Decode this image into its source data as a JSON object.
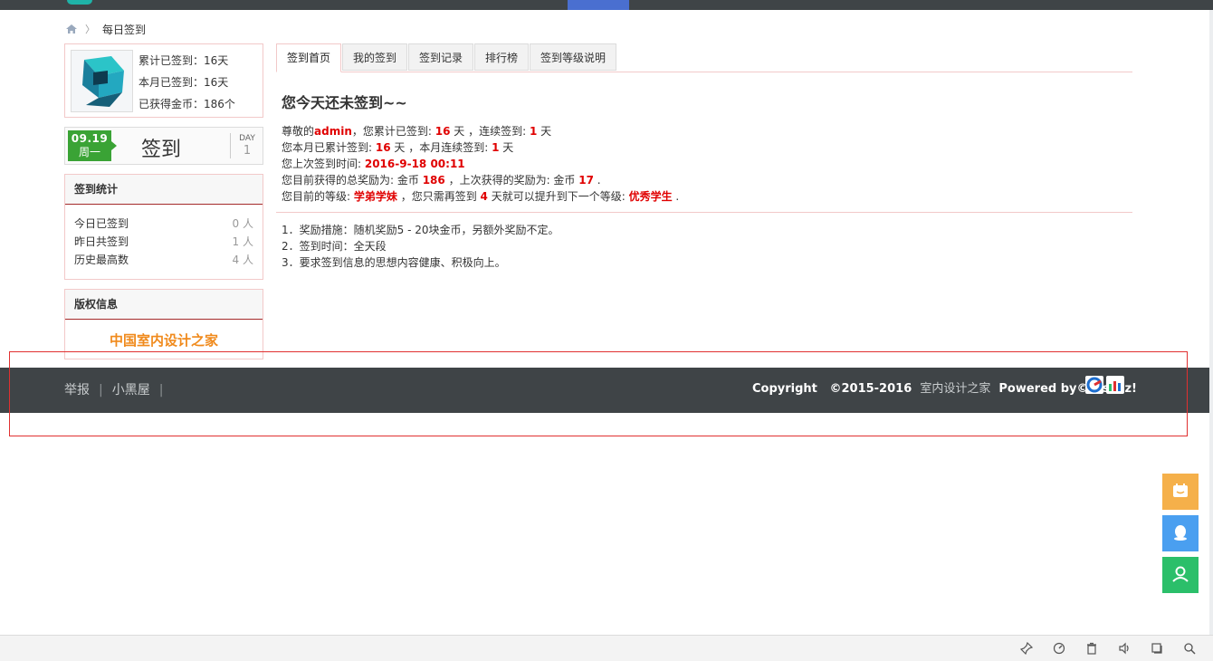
{
  "breadcrumb": {
    "current": "每日签到"
  },
  "user_card": {
    "total_signed": "累计已签到：16天",
    "month_signed": "本月已签到：16天",
    "coins": "已获得金币：186个"
  },
  "sign_box": {
    "date": "09.19",
    "weekday": "周一",
    "label": "签到",
    "day_label": "DAY",
    "day_value": "1"
  },
  "stats_panel": {
    "title": "签到统计",
    "rows": [
      {
        "label": "今日已签到",
        "value": "0 人"
      },
      {
        "label": "昨日共签到",
        "value": "1 人"
      },
      {
        "label": "历史最高数",
        "value": "4 人"
      }
    ]
  },
  "copyright_panel": {
    "title": "版权信息",
    "brand": "中国室内设计之家"
  },
  "tabs": [
    "签到首页",
    "我的签到",
    "签到记录",
    "排行榜",
    "签到等级说明"
  ],
  "main": {
    "heading": "您今天还未签到~~",
    "l1": {
      "a": "尊敬的",
      "user": "admin",
      "b": "，您累计已签到: ",
      "total": "16",
      "c": " 天 ，连续签到: ",
      "streak": "1",
      "d": " 天"
    },
    "l2": {
      "a": "您本月已累计签到: ",
      "month": "16",
      "b": " 天 ，本月连续签到: ",
      "mstreak": "1",
      "c": " 天"
    },
    "l3": {
      "a": "您上次签到时间: ",
      "time": "2016-9-18 00:11"
    },
    "l4": {
      "a": "您目前获得的总奖励为: 金币 ",
      "total_coins": "186",
      "b": " ，上次获得的奖励为: 金币 ",
      "last_coins": "17",
      "c": " ."
    },
    "l5": {
      "a": "您目前的等级: ",
      "level": "学弟学妹",
      "b": " ，您只需再签到 ",
      "need": "4",
      "c": " 天就可以提升到下一个等级: ",
      "next": "优秀学生",
      "d": " ."
    },
    "rules": [
      "1．奖励措施：随机奖励5 - 20块金币，另额外奖励不定。",
      "2．签到时间：全天段",
      "3．要求签到信息的思想内容健康、积极向上。"
    ]
  },
  "footer": {
    "link_report": "举报",
    "link_blackroom": "小黑屋",
    "copyright": "Copyright",
    "years": "©2015-2016",
    "site": "室内设计之家",
    "powered": "Powered by©Discuz!"
  },
  "colors": {
    "accent_red": "#e00000",
    "footer_bg": "#3f4447",
    "sign_green": "#3aa335",
    "brand_orange": "#f08a1c"
  }
}
